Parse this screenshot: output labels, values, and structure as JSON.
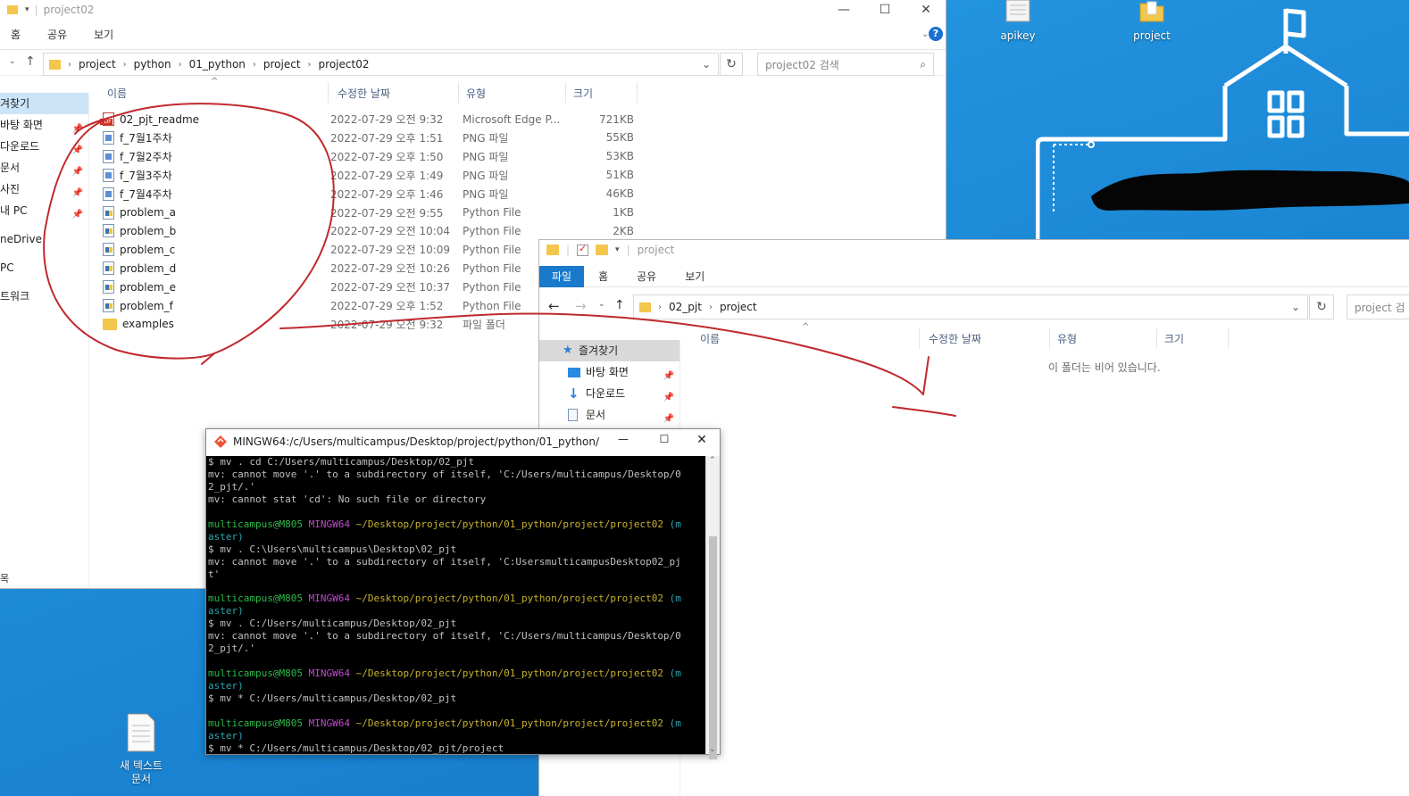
{
  "desktop": {
    "icons": [
      {
        "label": "apikey"
      },
      {
        "label": "project"
      },
      {
        "label": "새 텍스트\n문서"
      }
    ]
  },
  "explorer1": {
    "title": "project02",
    "ribbon": [
      "홈",
      "공유",
      "보기"
    ],
    "breadcrumb": [
      "project",
      "python",
      "01_python",
      "project",
      "project02"
    ],
    "search_placeholder": "project02 검색",
    "columns": {
      "name": "이름",
      "date": "수정한 날짜",
      "type": "유형",
      "size": "크기"
    },
    "nav": [
      "겨찾기",
      "바탕 화면",
      "다운로드",
      "문서",
      "사진",
      "내 PC",
      "neDrive",
      " PC",
      "트워크"
    ],
    "files": [
      {
        "name": "02_pjt_readme",
        "date": "2022-07-29 오전 9:32",
        "type": "Microsoft Edge P...",
        "size": "721KB",
        "icon": "pdf"
      },
      {
        "name": "f_7월1주차",
        "date": "2022-07-29 오후 1:51",
        "type": "PNG 파일",
        "size": "55KB",
        "icon": "png"
      },
      {
        "name": "f_7월2주차",
        "date": "2022-07-29 오후 1:50",
        "type": "PNG 파일",
        "size": "53KB",
        "icon": "png"
      },
      {
        "name": "f_7월3주차",
        "date": "2022-07-29 오후 1:49",
        "type": "PNG 파일",
        "size": "51KB",
        "icon": "png"
      },
      {
        "name": "f_7월4주차",
        "date": "2022-07-29 오후 1:46",
        "type": "PNG 파일",
        "size": "46KB",
        "icon": "png"
      },
      {
        "name": "problem_a",
        "date": "2022-07-29 오전 9:55",
        "type": "Python File",
        "size": "1KB",
        "icon": "py"
      },
      {
        "name": "problem_b",
        "date": "2022-07-29 오전 10:04",
        "type": "Python File",
        "size": "2KB",
        "icon": "py"
      },
      {
        "name": "problem_c",
        "date": "2022-07-29 오전 10:09",
        "type": "Python File",
        "size": "",
        "icon": "py"
      },
      {
        "name": "problem_d",
        "date": "2022-07-29 오전 10:26",
        "type": "Python File",
        "size": "",
        "icon": "py"
      },
      {
        "name": "problem_e",
        "date": "2022-07-29 오전 10:37",
        "type": "Python File",
        "size": "",
        "icon": "py"
      },
      {
        "name": "problem_f",
        "date": "2022-07-29 오후 1:52",
        "type": "Python File",
        "size": "",
        "icon": "py"
      },
      {
        "name": "examples",
        "date": "2022-07-29 오전 9:32",
        "type": "파일 폴더",
        "size": "",
        "icon": "folder"
      }
    ],
    "status": "목"
  },
  "explorer2": {
    "title": "project",
    "ribbon": [
      "파일",
      "홈",
      "공유",
      "보기"
    ],
    "breadcrumb": [
      "02_pjt",
      "project"
    ],
    "search_placeholder": "project 검",
    "columns": {
      "name": "이름",
      "date": "수정한 날짜",
      "type": "유형",
      "size": "크기"
    },
    "nav": [
      "즐겨찾기",
      "바탕 화면",
      "다운로드",
      "문서"
    ],
    "empty_message": "이 폴더는 비어 있습니다."
  },
  "terminal": {
    "title": "MINGW64:/c/Users/multicampus/Desktop/project/python/01_python/proj...",
    "lines": [
      {
        "segments": [
          {
            "t": "$ mv . cd C:/Users/multicampus/Desktop/02_pjt",
            "c": ""
          }
        ]
      },
      {
        "segments": [
          {
            "t": "mv: cannot move '.' to a subdirectory of itself, 'C:/Users/multicampus/Desktop/0",
            "c": ""
          }
        ]
      },
      {
        "segments": [
          {
            "t": "2_pjt/.'",
            "c": ""
          }
        ]
      },
      {
        "segments": [
          {
            "t": "mv: cannot stat 'cd': No such file or directory",
            "c": ""
          }
        ]
      },
      {
        "segments": [
          {
            "t": "",
            "c": ""
          }
        ]
      },
      {
        "segments": [
          {
            "t": "multicampus@M805 ",
            "c": "green"
          },
          {
            "t": "MINGW64 ",
            "c": "purple"
          },
          {
            "t": "~/Desktop/project/python/01_python/project/project02",
            "c": "yellow"
          },
          {
            "t": " (m",
            "c": "cyan"
          }
        ]
      },
      {
        "segments": [
          {
            "t": "aster)",
            "c": "cyan"
          }
        ]
      },
      {
        "segments": [
          {
            "t": "$ mv . C:\\Users\\multicampus\\Desktop\\02_pjt",
            "c": ""
          }
        ]
      },
      {
        "segments": [
          {
            "t": "mv: cannot move '.' to a subdirectory of itself, 'C:UsersmulticampusDesktop02_pj",
            "c": ""
          }
        ]
      },
      {
        "segments": [
          {
            "t": "t'",
            "c": ""
          }
        ]
      },
      {
        "segments": [
          {
            "t": "",
            "c": ""
          }
        ]
      },
      {
        "segments": [
          {
            "t": "multicampus@M805 ",
            "c": "green"
          },
          {
            "t": "MINGW64 ",
            "c": "purple"
          },
          {
            "t": "~/Desktop/project/python/01_python/project/project02",
            "c": "yellow"
          },
          {
            "t": " (m",
            "c": "cyan"
          }
        ]
      },
      {
        "segments": [
          {
            "t": "aster)",
            "c": "cyan"
          }
        ]
      },
      {
        "segments": [
          {
            "t": "$ mv . C:/Users/multicampus/Desktop/02_pjt",
            "c": ""
          }
        ]
      },
      {
        "segments": [
          {
            "t": "mv: cannot move '.' to a subdirectory of itself, 'C:/Users/multicampus/Desktop/0",
            "c": ""
          }
        ]
      },
      {
        "segments": [
          {
            "t": "2_pjt/.'",
            "c": ""
          }
        ]
      },
      {
        "segments": [
          {
            "t": "",
            "c": ""
          }
        ]
      },
      {
        "segments": [
          {
            "t": "multicampus@M805 ",
            "c": "green"
          },
          {
            "t": "MINGW64 ",
            "c": "purple"
          },
          {
            "t": "~/Desktop/project/python/01_python/project/project02",
            "c": "yellow"
          },
          {
            "t": " (m",
            "c": "cyan"
          }
        ]
      },
      {
        "segments": [
          {
            "t": "aster)",
            "c": "cyan"
          }
        ]
      },
      {
        "segments": [
          {
            "t": "$ mv * C:/Users/multicampus/Desktop/02_pjt",
            "c": ""
          }
        ]
      },
      {
        "segments": [
          {
            "t": "",
            "c": ""
          }
        ]
      },
      {
        "segments": [
          {
            "t": "multicampus@M805 ",
            "c": "green"
          },
          {
            "t": "MINGW64 ",
            "c": "purple"
          },
          {
            "t": "~/Desktop/project/python/01_python/project/project02",
            "c": "yellow"
          },
          {
            "t": " (m",
            "c": "cyan"
          }
        ]
      },
      {
        "segments": [
          {
            "t": "aster)",
            "c": "cyan"
          }
        ]
      },
      {
        "segments": [
          {
            "t": "$ mv * C:/Users/multicampus/Desktop/02_pjt/project",
            "c": ""
          }
        ]
      }
    ]
  },
  "colors": {
    "accent": "#1979ca",
    "annotation": "#c0282d",
    "desktop": "#1e8fdc"
  }
}
